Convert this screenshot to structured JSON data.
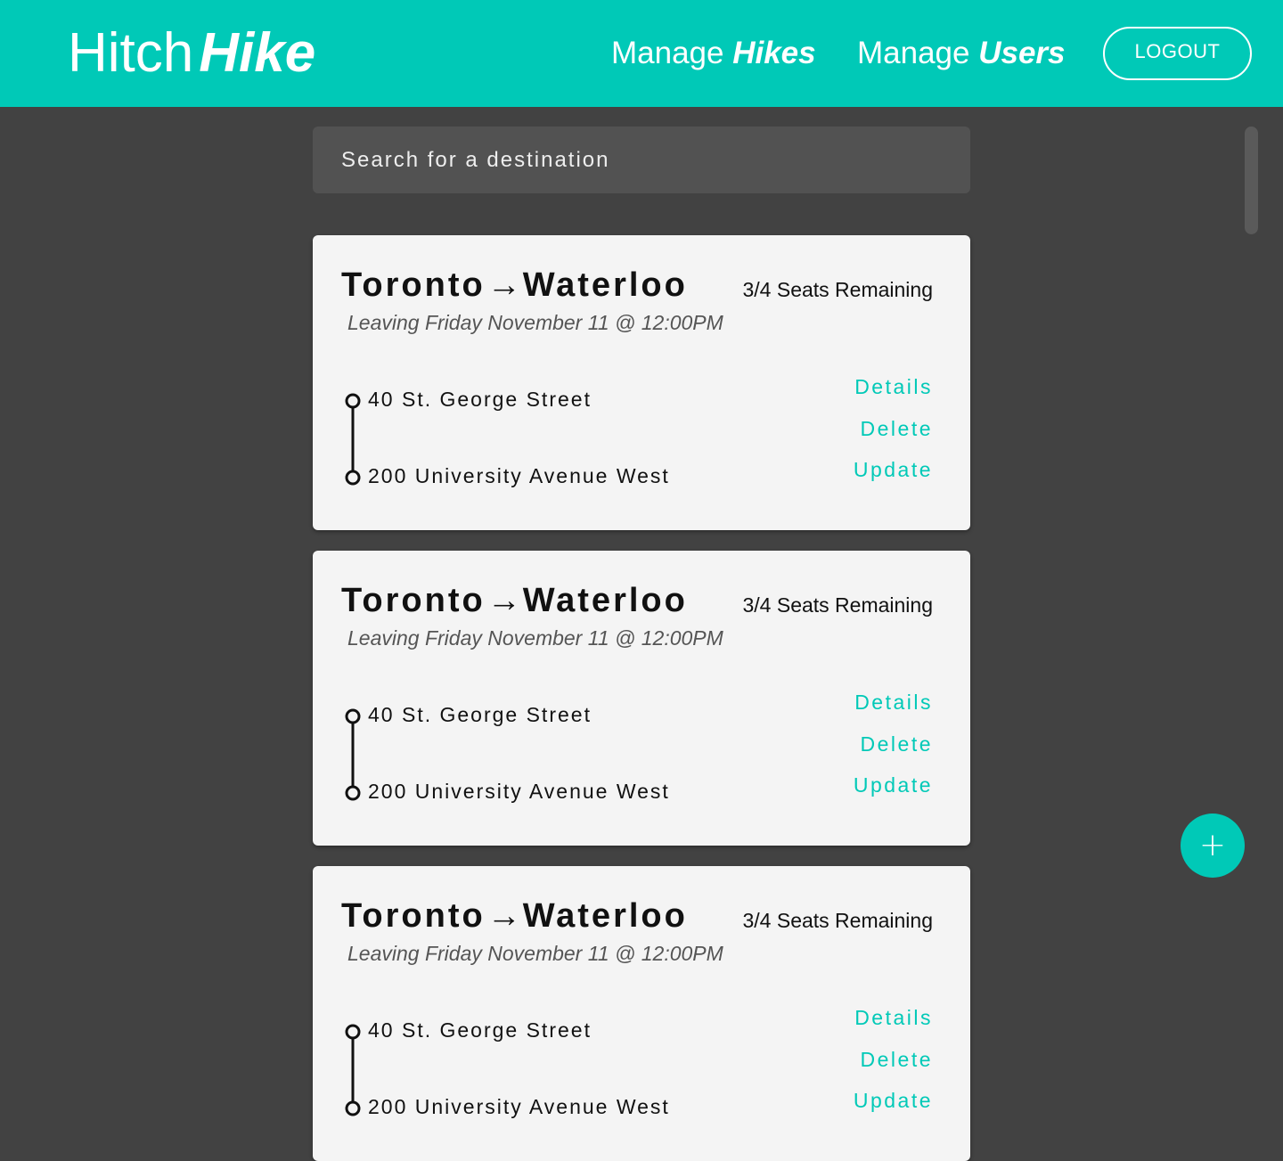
{
  "brand": {
    "name_light": "Hitch",
    "name_bold": "Hike"
  },
  "nav": {
    "hikes_prefix": "Manage ",
    "hikes_strong": "Hikes",
    "users_prefix": "Manage ",
    "users_strong": "Users",
    "logout_label": "LOGOUT"
  },
  "search": {
    "placeholder": "Search for a destination"
  },
  "cards": [
    {
      "from_city": "Toronto",
      "arrow": "→",
      "to_city": "Waterloo",
      "seats": "3/4 Seats Remaining",
      "leaving": "Leaving Friday November 11 @ 12:00PM",
      "from_address": "40 St. George Street",
      "to_address": "200 University Avenue West",
      "actions": {
        "details": "Details",
        "delete": "Delete",
        "update": "Update"
      }
    },
    {
      "from_city": "Toronto",
      "arrow": "→",
      "to_city": "Waterloo",
      "seats": "3/4 Seats Remaining",
      "leaving": "Leaving Friday November 11 @ 12:00PM",
      "from_address": "40 St. George Street",
      "to_address": "200 University Avenue West",
      "actions": {
        "details": "Details",
        "delete": "Delete",
        "update": "Update"
      }
    },
    {
      "from_city": "Toronto",
      "arrow": "→",
      "to_city": "Waterloo",
      "seats": "3/4 Seats Remaining",
      "leaving": "Leaving Friday November 11 @ 12:00PM",
      "from_address": "40 St. George Street",
      "to_address": "200 University Avenue West",
      "actions": {
        "details": "Details",
        "delete": "Delete",
        "update": "Update"
      }
    }
  ],
  "fab": {
    "icon": "plus-icon",
    "glyph": "+"
  },
  "colors": {
    "accent": "#00c9b7",
    "background": "#424242",
    "card": "#f4f4f4",
    "search_bg": "#525252"
  }
}
